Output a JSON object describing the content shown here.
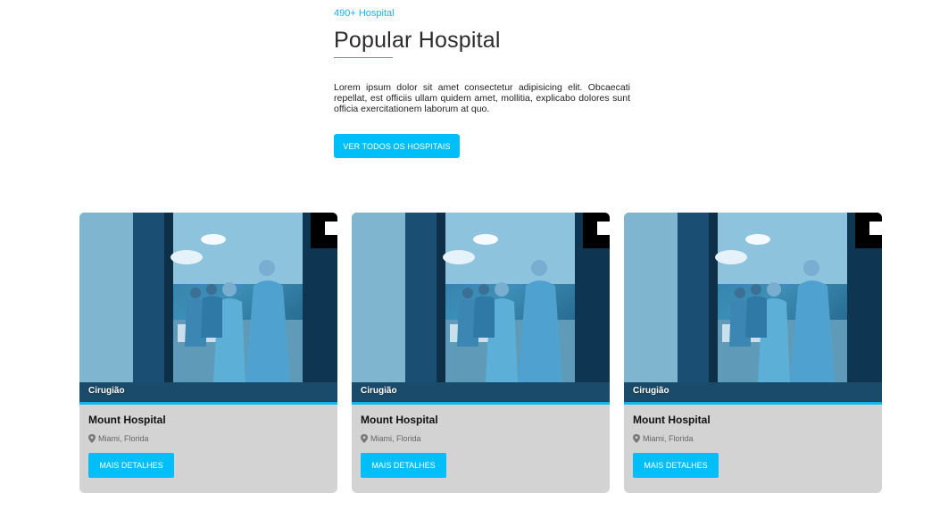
{
  "header": {
    "kicker": "490+ Hospital",
    "title": "Popular Hospital",
    "description": "Lorem ipsum dolor sit amet consectetur adipisicing elit. Obcaecati repellat, est officiis ullam quidem amet, mollitia, explicabo dolores sunt officia exercitationem laborum at quo.",
    "cta_label": "VER TODOS OS HOSPITAIS"
  },
  "cards": [
    {
      "category": "Cirugião",
      "title": "Mount Hospital",
      "location": "Miami, Florida",
      "button_label": "MAIS DETALHES"
    },
    {
      "category": "Cirugião",
      "title": "Mount Hospital",
      "location": "Miami, Florida",
      "button_label": "MAIS DETALHES"
    },
    {
      "category": "Cirugião",
      "title": "Mount Hospital",
      "location": "Miami, Florida",
      "button_label": "MAIS DETALHES"
    }
  ],
  "colors": {
    "accent": "#12b5e8",
    "button": "#00bff8",
    "card_bg": "#d3d3d3"
  },
  "icons": {
    "location": "map-pin-icon"
  }
}
